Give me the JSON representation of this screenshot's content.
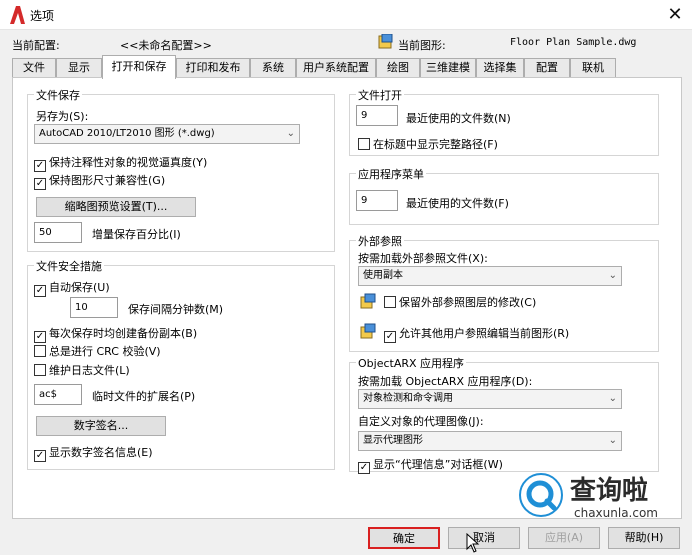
{
  "window": {
    "title": "选项",
    "close_glyph": "✕"
  },
  "profile": {
    "current_profile_label": "当前配置:",
    "current_profile_value": "<<未命名配置>>",
    "current_drawing_label": "当前图形:",
    "current_drawing_value": "Floor Plan Sample.dwg"
  },
  "tabs": [
    {
      "label": "文件"
    },
    {
      "label": "显示"
    },
    {
      "label": "打开和保存",
      "active": true
    },
    {
      "label": "打印和发布"
    },
    {
      "label": "系统"
    },
    {
      "label": "用户系统配置"
    },
    {
      "label": "绘图"
    },
    {
      "label": "三维建模"
    },
    {
      "label": "选择集"
    },
    {
      "label": "配置"
    },
    {
      "label": "联机"
    }
  ],
  "file_save": {
    "title": "文件保存",
    "save_as_label": "另存为(S):",
    "save_as_value": "AutoCAD 2010/LT2010 图形 (*.dwg)",
    "maintain_visual_fidelity": "保持注释性对象的视觉逼真度(Y)",
    "maintain_drawing_size": "保持图形尺寸兼容性(G)",
    "thumbnail_button": "缩略图预览设置(T)...",
    "incremental_value": "50",
    "incremental_label": "增量保存百分比(I)"
  },
  "file_safety": {
    "title": "文件安全措施",
    "autosave": "自动保存(U)",
    "minutes_value": "10",
    "minutes_label": "保存间隔分钟数(M)",
    "backup_copy": "每次保存时均创建备份副本(B)",
    "crc_check": "总是进行 CRC 校验(V)",
    "log_file": "维护日志文件(L)",
    "temp_ext_value": "ac$",
    "temp_ext_label": "临时文件的扩展名(P)",
    "digital_sign_button": "数字签名...",
    "show_digital_sign": "显示数字签名信息(E)"
  },
  "file_open": {
    "title": "文件打开",
    "recent_value": "9",
    "recent_label": "最近使用的文件数(N)",
    "full_path": "在标题中显示完整路径(F)"
  },
  "app_menu": {
    "title": "应用程序菜单",
    "recent_value": "9",
    "recent_label": "最近使用的文件数(F)"
  },
  "xref": {
    "title": "外部参照",
    "demand_load_label": "按需加载外部参照文件(X):",
    "demand_load_value": "使用副本",
    "retain_changes": "保留外部参照图层的修改(C)",
    "allow_edit": "允许其他用户参照编辑当前图形(R)"
  },
  "objectarx": {
    "title": "ObjectARX 应用程序",
    "demand_load_label": "按需加载 ObjectARX 应用程序(D):",
    "demand_load_value": "对象检测和命令调用",
    "proxy_label": "自定义对象的代理图像(J):",
    "proxy_value": "显示代理图形",
    "show_proxy_dialog": "显示“代理信息”对话框(W)"
  },
  "buttons": {
    "ok": "确定",
    "cancel": "取消",
    "apply": "应用(A)",
    "help": "帮助(H)"
  },
  "watermark": {
    "brand": "查询啦",
    "url": "chaxunla.com"
  },
  "colors": {
    "accent_red": "#d92020",
    "watermark_blue": "#1f8fd6"
  }
}
